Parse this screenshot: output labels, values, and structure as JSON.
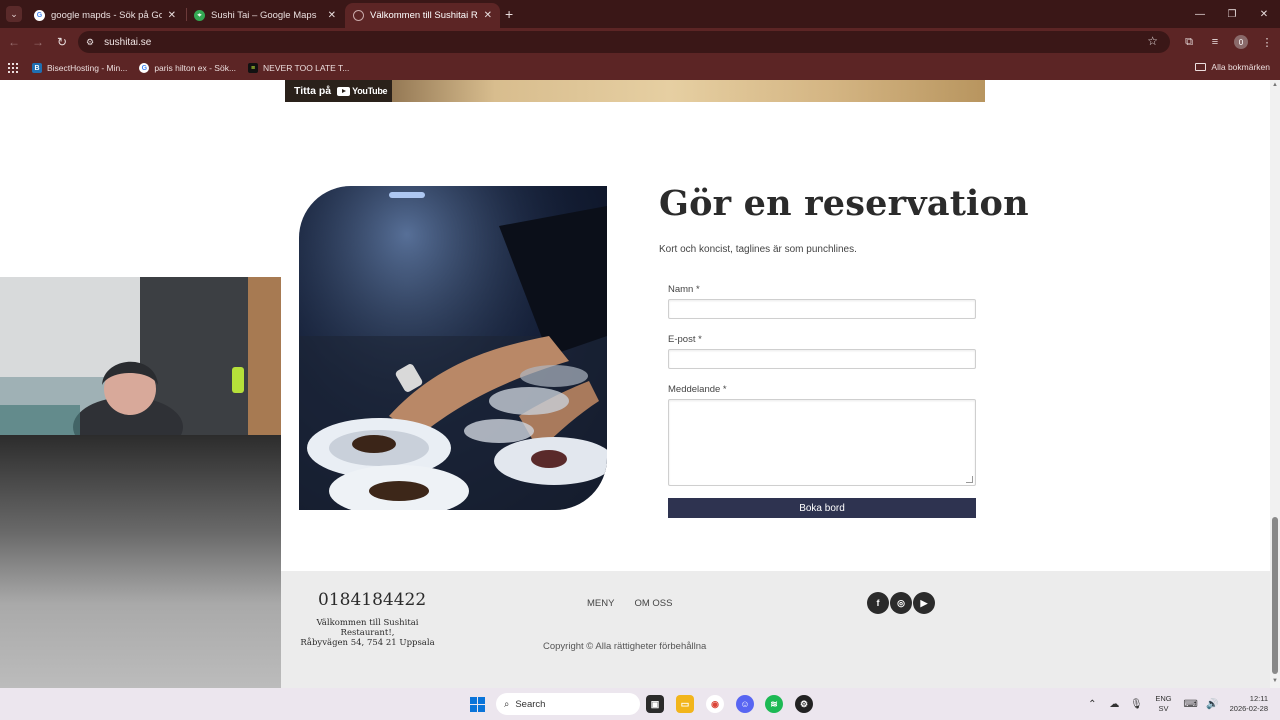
{
  "browser": {
    "tabs": [
      {
        "title": "google mapds - Sök på Google",
        "icon": "google-icon",
        "active": false
      },
      {
        "title": "Sushi Tai – Google Maps",
        "icon": "maps-icon",
        "active": false
      },
      {
        "title": "Välkommen till Sushitai Restaurant",
        "icon": "loading-icon",
        "active": true
      }
    ],
    "url": "sushitai.se",
    "profile_initial": "0",
    "bookmarks": [
      {
        "label": "BisectHosting - Min...",
        "icon": "bisect-icon"
      },
      {
        "label": "paris hilton ex - Sök...",
        "icon": "google-icon"
      },
      {
        "label": "NEVER TOO LATE T...",
        "icon": "app-icon"
      }
    ],
    "all_bookmarks": "Alla bokmärken"
  },
  "video": {
    "watch_on": "Titta på",
    "brand": "YouTube"
  },
  "reservation": {
    "title": "Gör en reservation",
    "tagline": "Kort och koncist, taglines är som punchlines.",
    "name_label": "Namn *",
    "email_label": "E-post *",
    "message_label": "Meddelande *",
    "submit_label": "Boka bord"
  },
  "footer": {
    "phone": "0184184422",
    "address_line1": "Välkommen till Sushitai Restaurant!,",
    "address_line2": "Råbyvägen 54, 754 21 Uppsala",
    "nav": [
      "MENY",
      "OM OSS"
    ],
    "social_icons": [
      "facebook-icon",
      "instagram-icon",
      "youtube-icon"
    ],
    "copyright": "Copyright © Alla rättigheter förbehållna"
  },
  "taskbar": {
    "search_placeholder": "Search",
    "lang_top": "ENG",
    "lang_bottom": "SV",
    "time": "12:11",
    "date": "2026-02-28"
  },
  "colors": {
    "chrome_dark": "#3a1717",
    "chrome": "#5c2525",
    "button": "#2e3350",
    "footer": "#ececec"
  }
}
